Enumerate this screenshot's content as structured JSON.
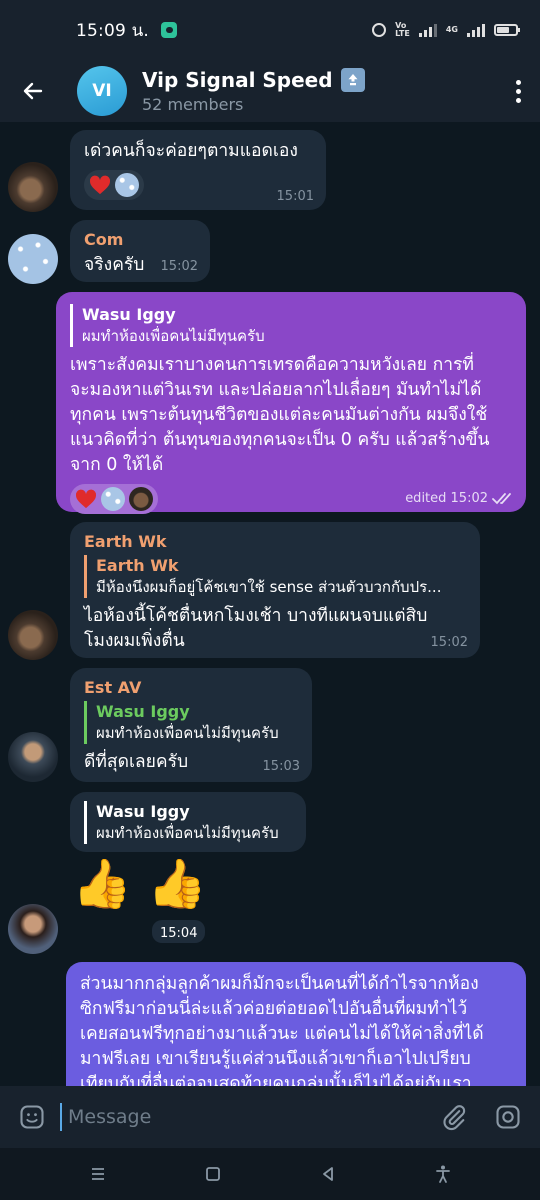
{
  "status": {
    "time": "15:09 น.",
    "network_vo": "Vo",
    "network_lte": "LTE",
    "network_4g": "4G"
  },
  "header": {
    "avatar_initials": "VI",
    "title": "Vip Signal Speed",
    "title_emoji": "up-arrow-emoji",
    "members": "52 members"
  },
  "messages": [
    {
      "text": "เด่วคนก็จะค่อยๆตามแอดเอง",
      "time": "15:01",
      "reactions": [
        "heart",
        "stars-avatar"
      ]
    },
    {
      "sender": "Com",
      "sender_color": "#f0a070",
      "text": "จริงครับ",
      "time": "15:02"
    },
    {
      "reply_name": "Wasu Iggy",
      "reply_text": "ผมทำห้องเพื่อคนไม่มีทุนครับ",
      "lines": [
        "เพราะสังคมเราบางคนการเทรดคือความหวังเลย การที่",
        "จะมองหาแต่วินเรท และปล่อยลากไปเลื่อยๆ มันทำไม่ได้",
        "ทุกคน เพราะต้นทุนชีวิตของแต่ละคนมันต่างกัน ผมจึงใช้",
        "แนวคิดที่ว่า ต้นทุนของทุกคนจะเป็น 0 ครับ แล้วสร้างขึ้น",
        "จาก 0 ให้ได้"
      ],
      "time": "edited 15:02",
      "reactions": [
        "heart",
        "stars-avatar",
        "cat-avatar"
      ]
    },
    {
      "sender": "Earth Wk",
      "sender_color": "#f0a070",
      "reply_name": "Earth Wk",
      "reply_text": "มีห้องนึงผมก็อยู่โค้ชเขาใช้ sense ส่วนตัวบวกกับปร...",
      "lines": [
        "ไอห้องนี้โค้ชตื่นหกโมงเช้า บางทีแผนจบแต่สิบ",
        "โมงผมเพิ่งตื่น"
      ],
      "time": "15:02"
    },
    {
      "sender": "Est AV",
      "sender_color": "#f0a070",
      "reply_name": "Wasu Iggy",
      "reply_text": "ผมทำห้องเพื่อคนไม่มีทุนครับ",
      "text": "ดีที่สุดเลยครับ",
      "time": "15:03"
    },
    {
      "reply_name": "Wasu Iggy",
      "reply_text": "ผมทำห้องเพื่อคนไม่มีทุนครับ",
      "sticker": "👍 👍",
      "time": "15:04"
    },
    {
      "lines": [
        "ส่วนมากกลุ่มลูกค้าผมก็มักจะเป็นคนที่ได้กำไรจากห้อง",
        "ซิกฟรีมาก่อนนี่ล่ะแล้วค่อยต่อยอดไปอันอื่นที่ผมทำไว้",
        "เคยสอนฟรีทุกอย่างมาแล้วนะ แต่คนไม่ได้ให้ค่าสิ่งที่ได้",
        "มาฟรีเลย เขาเรียนรู้แค่ส่วนนึงแล้วเขาก็เอาไปเปรียบ",
        "เทียบกับที่อื่นต่อจนสุดท้ายคนกลุ่มนั้นก็ไม่ได้อยู่กับเรา"
      ]
    }
  ],
  "input": {
    "placeholder": "Message"
  },
  "colors": {
    "header_bg": "#18222d",
    "chat_bg": "#0d1820",
    "incoming_bubble": "#1e2c3a",
    "outgoing_bubble": "#8a47c8",
    "outgoing_bubble_2": "#6b5de0",
    "accent": "#5aa9e6"
  }
}
